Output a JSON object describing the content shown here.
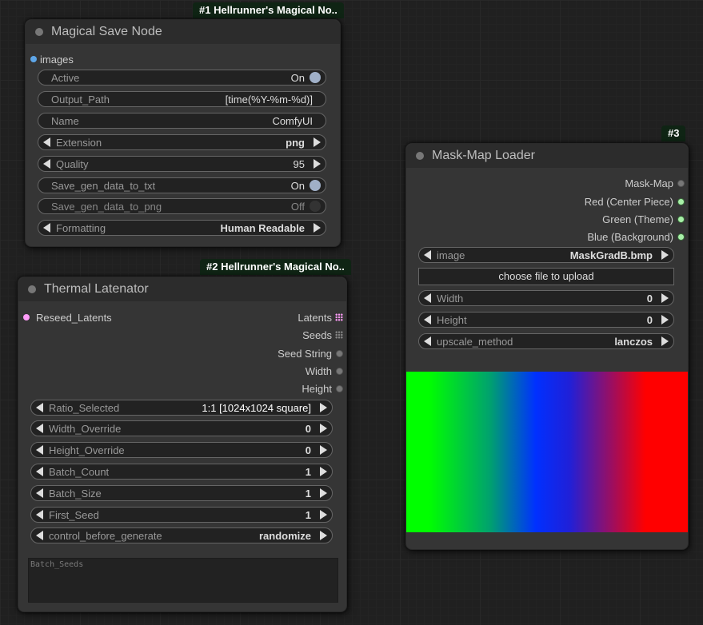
{
  "colors": {
    "image_slot": "#5ea6e8",
    "latent_slot": "#ff9cf9",
    "seeds_slot": "#888888",
    "mask_out": "#888888",
    "channel_out": "#a8f0a8",
    "toggle_on": "#a0b0c8",
    "toggle_off": "#333333",
    "badge_bg": "#0f2414"
  },
  "node1": {
    "badge": "#1 Hellrunner's Magical No..",
    "title": "Magical Save Node",
    "inputs": [
      {
        "label": "images",
        "icon": "blue-dot"
      }
    ],
    "widgets": [
      {
        "type": "toggle",
        "label": "Active",
        "value": "On",
        "on": true
      },
      {
        "type": "text",
        "label": "Output_Path",
        "value": "[time(%Y-%m-%d)]"
      },
      {
        "type": "text",
        "label": "Name",
        "value": "ComfyUI"
      },
      {
        "type": "combo",
        "label": "Extension",
        "value": "png"
      },
      {
        "type": "number",
        "label": "Quality",
        "value": "95"
      },
      {
        "type": "toggle",
        "label": "Save_gen_data_to_txt",
        "value": "On",
        "on": true
      },
      {
        "type": "toggle",
        "label": "Save_gen_data_to_png",
        "value": "Off",
        "on": false
      },
      {
        "type": "combo",
        "label": "Formatting",
        "value": "Human Readable"
      }
    ]
  },
  "node2": {
    "badge": "#2 Hellrunner's Magical No..",
    "title": "Thermal Latenator",
    "inputs": [
      {
        "label": "Reseed_Latents",
        "icon": "pink-dot"
      }
    ],
    "outputs": [
      {
        "label": "Latents",
        "icon": "grid-icon"
      },
      {
        "label": "Seeds",
        "icon": "grid-icon"
      },
      {
        "label": "Seed String",
        "icon": "dot"
      },
      {
        "label": "Width",
        "icon": "dot"
      },
      {
        "label": "Height",
        "icon": "dot"
      }
    ],
    "widgets": [
      {
        "type": "combo",
        "label": "Ratio_Selected",
        "value": "1:1 [1024x1024 square]"
      },
      {
        "type": "number",
        "label": "Width_Override",
        "value": "0"
      },
      {
        "type": "number",
        "label": "Height_Override",
        "value": "0"
      },
      {
        "type": "number",
        "label": "Batch_Count",
        "value": "1"
      },
      {
        "type": "number",
        "label": "Batch_Size",
        "value": "1"
      },
      {
        "type": "number",
        "label": "First_Seed",
        "value": "1"
      },
      {
        "type": "combo",
        "label": "control_before_generate",
        "value": "randomize"
      }
    ],
    "textarea_placeholder": "Batch_Seeds"
  },
  "node3": {
    "badge": "#3",
    "title": "Mask-Map Loader",
    "outputs": [
      {
        "label": "Mask-Map",
        "icon": "dot"
      },
      {
        "label": "Red (Center Piece)",
        "icon": "green-dot"
      },
      {
        "label": "Green (Theme)",
        "icon": "green-dot"
      },
      {
        "label": "Blue (Background)",
        "icon": "green-dot"
      }
    ],
    "image_widget": {
      "label": "image",
      "value": "MaskGradB.bmp"
    },
    "upload_button": "choose file to upload",
    "widgets": [
      {
        "type": "number",
        "label": "Width",
        "value": "0"
      },
      {
        "type": "number",
        "label": "Height",
        "value": "0"
      },
      {
        "type": "combo",
        "label": "upscale_method",
        "value": "lanczos"
      }
    ],
    "preview": "green-teal-blue-red horizontal gradient"
  }
}
